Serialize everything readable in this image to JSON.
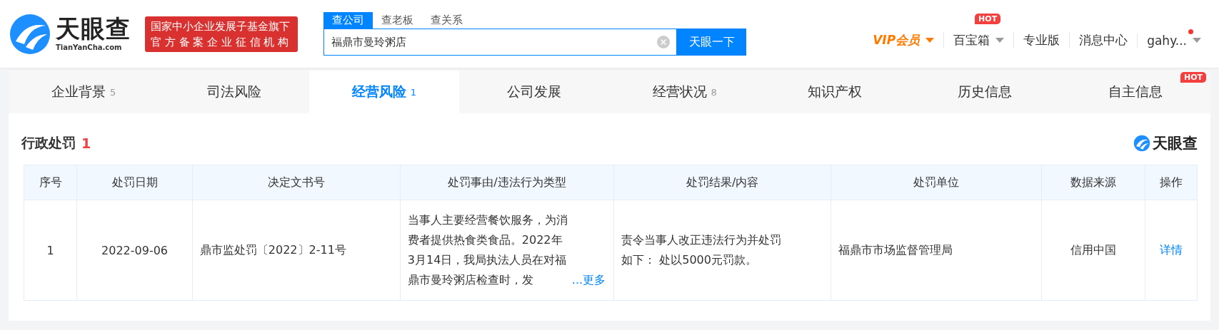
{
  "header": {
    "logo": {
      "name": "天眼查",
      "domain": "TianYanCha.com"
    },
    "badge": [
      "国家中小企业发展子基金旗下",
      "官方备案企业征信机构"
    ],
    "search": {
      "tabs": [
        {
          "label": "查公司",
          "selected": true
        },
        {
          "label": "查老板",
          "selected": false
        },
        {
          "label": "查关系",
          "selected": false
        }
      ],
      "value": "福鼎市曼玲粥店",
      "button": "天眼一下"
    },
    "nav": [
      {
        "kind": "vip",
        "label": "VIP会员"
      },
      {
        "kind": "menu",
        "label": "百宝箱",
        "badge": "HOT"
      },
      {
        "kind": "link",
        "label": "专业版"
      },
      {
        "kind": "link",
        "label": "消息中心"
      },
      {
        "kind": "user",
        "label": "gahy...",
        "unread": true
      }
    ]
  },
  "tabs": [
    {
      "label": "企业背景",
      "count": "5",
      "selected": false
    },
    {
      "label": "司法风险",
      "selected": false
    },
    {
      "label": "经营风险",
      "count": "1",
      "selected": true
    },
    {
      "label": "公司发展",
      "selected": false
    },
    {
      "label": "经营状况",
      "count": "8",
      "selected": false
    },
    {
      "label": "知识产权",
      "selected": false
    },
    {
      "label": "历史信息",
      "selected": false
    },
    {
      "label": "自主信息",
      "badge": "HOT",
      "selected": false
    }
  ],
  "section": {
    "title": "行政处罚",
    "count": "1",
    "brand": "天眼查"
  },
  "table": {
    "columns": [
      "序号",
      "处罚日期",
      "决定文书号",
      "处罚事由/违法行为类型",
      "处罚结果/内容",
      "处罚单位",
      "数据来源",
      "操作"
    ],
    "rows": [
      {
        "index": "1",
        "date": "2022-09-06",
        "doc_no": "鼎市监处罚〔2022〕2-11号",
        "reason": "当事人主要经营餐饮服务，为消费者提供热食类食品。2022年3月14日，我局执法人员在对福鼎市曼玲粥店检查时，发",
        "more": "...更多",
        "result": "责令当事人改正违法行为并处罚如下： 处以5000元罚款。",
        "unit": "福鼎市市场监督管理局",
        "source": "信用中国",
        "action": "详情"
      }
    ]
  }
}
